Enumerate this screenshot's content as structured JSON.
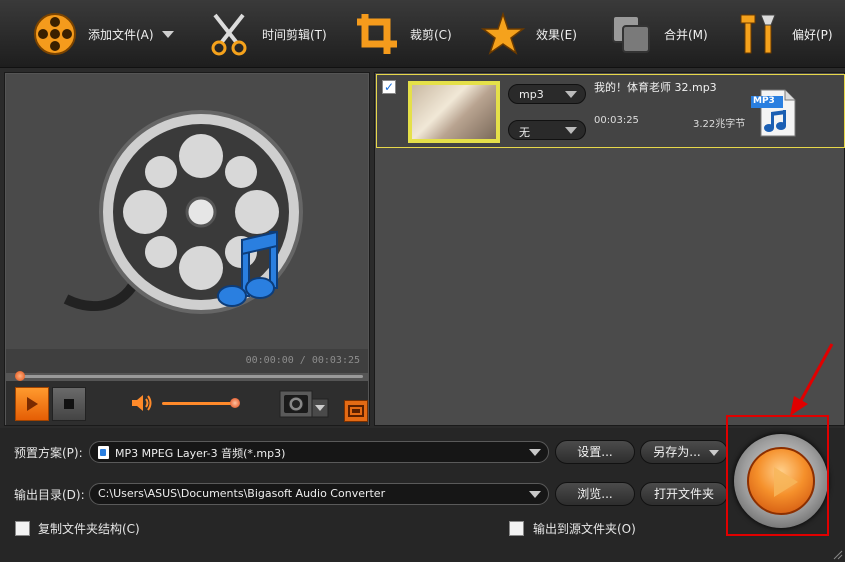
{
  "toolbar": {
    "add_file": "添加文件(A)",
    "trim": "时间剪辑(T)",
    "crop": "裁剪(C)",
    "effect": "效果(E)",
    "merge": "合并(M)",
    "preferences": "偏好(P)"
  },
  "preview": {
    "time": "00:00:00 / 00:03:25",
    "seek_progress": 0.0,
    "volume_level": 0.9
  },
  "file": {
    "checked": true,
    "format": "mp3",
    "subtitle": "无",
    "name": "我的！体育老师 32.mp3",
    "duration": "00:03:25",
    "size": "3.22兆字节",
    "badge": "MP3"
  },
  "bottom": {
    "preset_label": "预置方案(P):",
    "preset_value": "MP3 MPEG Layer-3 音频(*.mp3)",
    "settings_btn": "设置...",
    "save_as_btn": "另存为...",
    "output_label": "输出目录(D):",
    "output_value": "C:\\Users\\ASUS\\Documents\\Bigasoft Audio Converter",
    "browse_btn": "浏览...",
    "open_folder_btn": "打开文件夹",
    "copy_structure": "复制文件夹结构(C)",
    "output_to_source": "输出到源文件夹(O)"
  },
  "colors": {
    "accent_orange": "#f5902b",
    "selection_border": "#e7d84a",
    "highlight_red": "#e00000"
  }
}
